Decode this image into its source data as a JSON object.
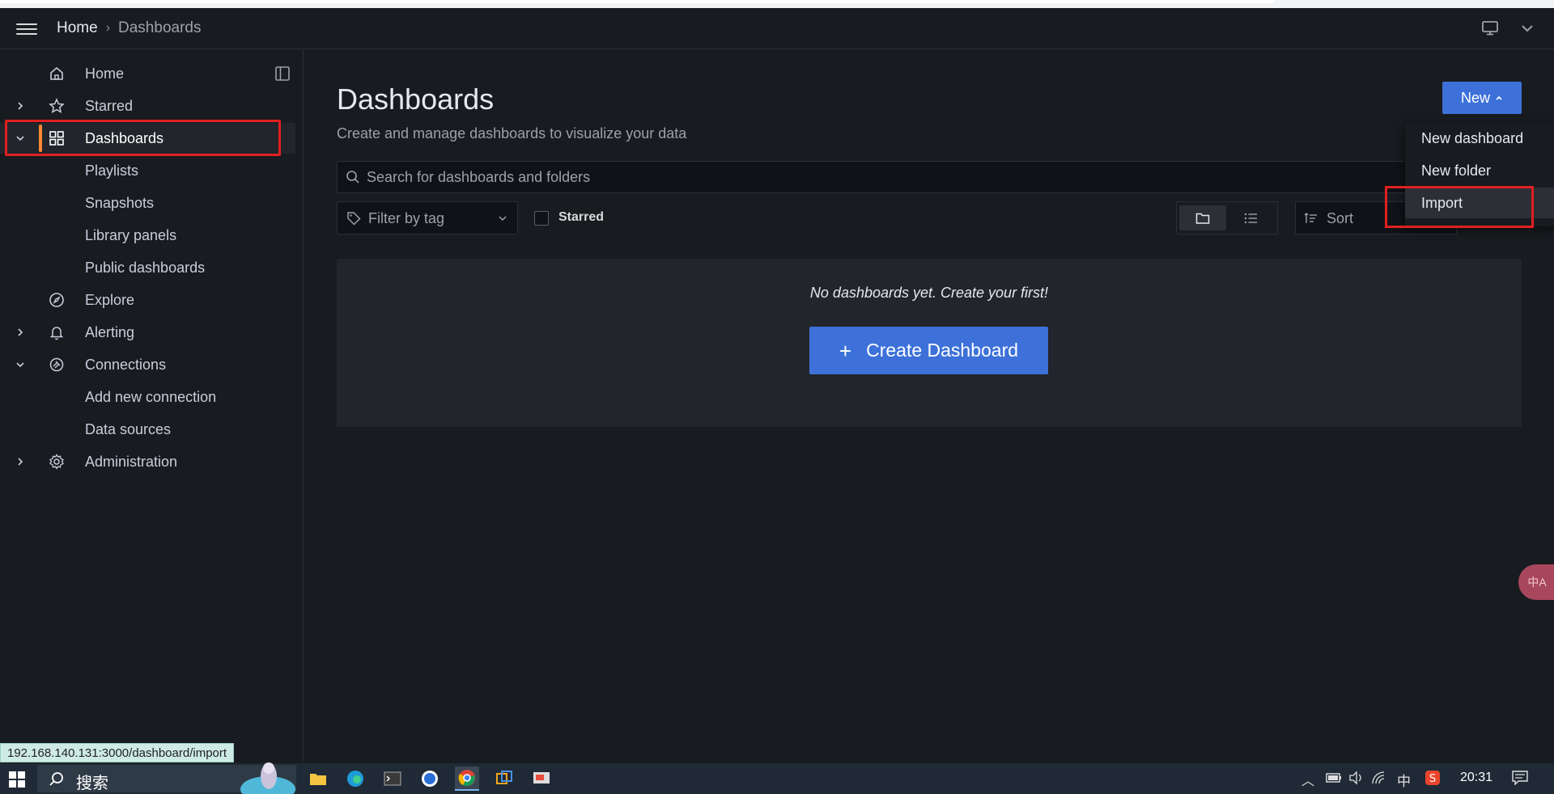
{
  "topbar": {
    "breadcrumb_home": "Home",
    "breadcrumb_separator": "›",
    "breadcrumb_current": "Dashboards"
  },
  "sidebar": {
    "items": [
      {
        "label": "Home"
      },
      {
        "label": "Starred"
      },
      {
        "label": "Dashboards"
      },
      {
        "label": "Playlists"
      },
      {
        "label": "Snapshots"
      },
      {
        "label": "Library panels"
      },
      {
        "label": "Public dashboards"
      },
      {
        "label": "Explore"
      },
      {
        "label": "Alerting"
      },
      {
        "label": "Connections"
      },
      {
        "label": "Add new connection"
      },
      {
        "label": "Data sources"
      },
      {
        "label": "Administration"
      }
    ]
  },
  "main": {
    "title": "Dashboards",
    "subtitle": "Create and manage dashboards to visualize your data",
    "new_button": "New",
    "search_placeholder": "Search for dashboards and folders",
    "filter_placeholder": "Filter by tag",
    "starred_label": "Starred",
    "sort_label": "Sort",
    "empty_message": "No dashboards yet. Create your first!",
    "create_button": "Create Dashboard",
    "create_plus": "+"
  },
  "new_menu": {
    "items": [
      "New dashboard",
      "New folder",
      "Import"
    ]
  },
  "status_url": "192.168.140.131:3000/dashboard/import",
  "translate_bubble": "中A",
  "taskbar": {
    "search_text": "搜索",
    "ime": "中",
    "clock": "20:31"
  },
  "colors": {
    "accent": "#3d71d9",
    "active_marker": "#ff8833",
    "highlight_box": "#e02020",
    "background": "#181b1f"
  }
}
